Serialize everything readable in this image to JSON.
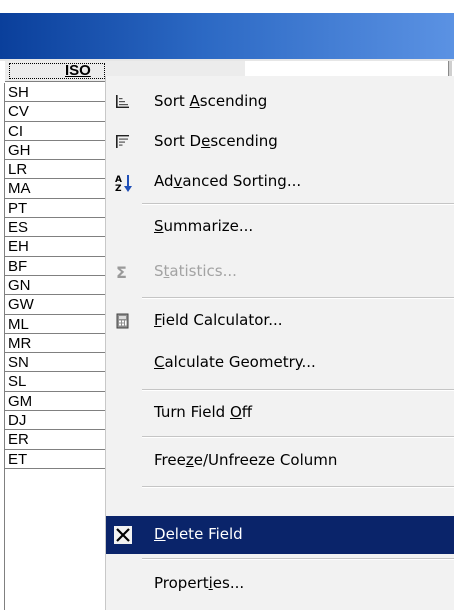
{
  "table": {
    "column_header": "ISO",
    "rows": [
      "SH",
      "CV",
      "CI",
      "GH",
      "LR",
      "MA",
      "PT",
      "ES",
      "EH",
      "BF",
      "GN",
      "GW",
      "ML",
      "MR",
      "SN",
      "SL",
      "GM",
      "DJ",
      "ER",
      "ET"
    ]
  },
  "menu": {
    "items": [
      {
        "pre": "Sort ",
        "mn": "A",
        "post": "scending",
        "icon": "sort-ascending-icon",
        "disabled": false,
        "selected": false
      },
      {
        "pre": "Sort D",
        "mn": "e",
        "post": "scending",
        "icon": "sort-descending-icon",
        "disabled": false,
        "selected": false
      },
      {
        "pre": "Ad",
        "mn": "v",
        "post": "anced Sorting...",
        "icon": "advanced-sorting-icon",
        "disabled": false,
        "selected": false
      },
      {
        "pre": "",
        "mn": "S",
        "post": "ummarize...",
        "icon": "",
        "disabled": false,
        "selected": false
      },
      {
        "pre": "S",
        "mn": "t",
        "post": "atistics...",
        "icon": "sigma-icon",
        "disabled": true,
        "selected": false
      },
      {
        "pre": "",
        "mn": "F",
        "post": "ield Calculator...",
        "icon": "calculator-icon",
        "disabled": false,
        "selected": false
      },
      {
        "pre": "",
        "mn": "C",
        "post": "alculate Geometry...",
        "icon": "",
        "disabled": false,
        "selected": false
      },
      {
        "pre": "Turn Field ",
        "mn": "O",
        "post": "ff",
        "icon": "",
        "disabled": false,
        "selected": false
      },
      {
        "pre": "Free",
        "mn": "z",
        "post": "e/Unfreeze Column",
        "icon": "",
        "disabled": false,
        "selected": false
      },
      {
        "pre": "",
        "mn": "D",
        "post": "elete Field",
        "icon": "delete-x-icon",
        "disabled": false,
        "selected": true
      },
      {
        "pre": "Propert",
        "mn": "i",
        "post": "es...",
        "icon": "",
        "disabled": false,
        "selected": false
      }
    ]
  },
  "colors": {
    "selection": "#0a246a",
    "menu_bg": "#f2f2f2",
    "title_bar": "#0a3f9b"
  }
}
